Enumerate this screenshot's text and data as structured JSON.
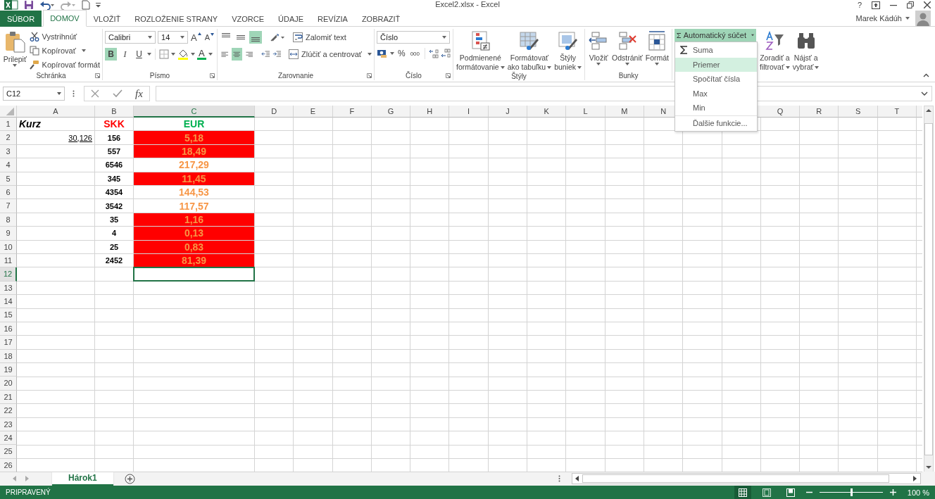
{
  "title_bar": {
    "title": "Excel2.xlsx - Excel",
    "help": "?"
  },
  "tabs": [
    {
      "label": "SÚBOR",
      "kind": "file",
      "selected": false
    },
    {
      "label": "DOMOV",
      "kind": "tab",
      "selected": true
    },
    {
      "label": "VLOŽIŤ",
      "kind": "tab",
      "selected": false
    },
    {
      "label": "ROZLOŽENIE STRANY",
      "kind": "tab",
      "selected": false
    },
    {
      "label": "VZORCE",
      "kind": "tab",
      "selected": false
    },
    {
      "label": "ÚDAJE",
      "kind": "tab",
      "selected": false
    },
    {
      "label": "REVÍZIA",
      "kind": "tab",
      "selected": false
    },
    {
      "label": "ZOBRAZIŤ",
      "kind": "tab",
      "selected": false
    }
  ],
  "user": {
    "name": "Marek Kádúh"
  },
  "ribbon": {
    "clipboard": {
      "label": "Schránka",
      "paste": "Prilepiť",
      "cut": "Vystrihnúť",
      "copy": "Kopírovať",
      "format_painter": "Kopírovať formát"
    },
    "font": {
      "label": "Písmo",
      "family": "Calibri",
      "size": "14",
      "grow": "A",
      "shrink": "A",
      "styles": [
        {
          "label": "B",
          "kind": "bold",
          "on": true
        },
        {
          "label": "I",
          "kind": "italic",
          "on": false
        },
        {
          "label": "U",
          "kind": "underline",
          "on": false
        }
      ],
      "color_letter": "A"
    },
    "alignment": {
      "label": "Zarovnanie",
      "vertical": [
        {
          "kind": "top",
          "on": false
        },
        {
          "kind": "middle",
          "on": false
        },
        {
          "kind": "bottom",
          "on": true
        }
      ],
      "horizontal": [
        {
          "kind": "left",
          "on": false
        },
        {
          "kind": "center",
          "on": true
        },
        {
          "kind": "right",
          "on": false
        }
      ],
      "wrap": "Zalomiť text",
      "merge": "Zlúčiť a centrovať"
    },
    "number": {
      "label": "Číslo",
      "format": "Číslo",
      "percent": "%",
      "thousands": "000"
    },
    "styles": {
      "label": "Štýly",
      "buttons": [
        {
          "kind": "conditional",
          "line1": "Podmienené",
          "line2": "formátovanie"
        },
        {
          "kind": "table",
          "line1": "Formátovať",
          "line2": "ako tabuľku"
        },
        {
          "kind": "cellstyle",
          "line1": "Štýly",
          "line2": "buniek"
        }
      ]
    },
    "cells": {
      "label": "Bunky",
      "buttons": [
        {
          "kind": "insert",
          "label": "Vložiť"
        },
        {
          "kind": "delete",
          "label": "Odstrániť"
        },
        {
          "kind": "format",
          "label": "Formát"
        }
      ]
    },
    "editing": {
      "autosum": "Automatický súčet",
      "autosum_open": true,
      "buttons": [
        {
          "kind": "sort",
          "line1": "Zoradiť a",
          "line2": "filtrovať"
        },
        {
          "kind": "find",
          "line1": "Nájsť a",
          "line2": "vybrať"
        }
      ]
    }
  },
  "autosum_menu": [
    {
      "label": "Suma",
      "kind": "sum",
      "selected": false
    },
    {
      "label": "Priemer",
      "kind": "plain",
      "selected": true
    },
    {
      "label": "Spočítať čísla",
      "kind": "plain",
      "selected": false
    },
    {
      "label": "Max",
      "kind": "plain",
      "selected": false
    },
    {
      "label": "Min",
      "kind": "plain",
      "selected": false
    },
    {
      "label": "Ďalšie funkcie...",
      "kind": "more",
      "selected": false
    }
  ],
  "formula_bar": {
    "name_box": "C12",
    "fx": "fx"
  },
  "sheet": {
    "columns": [
      {
        "label": "A",
        "selected": false
      },
      {
        "label": "B",
        "selected": false
      },
      {
        "label": "C",
        "selected": true
      },
      {
        "label": "D",
        "selected": false
      },
      {
        "label": "E",
        "selected": false
      },
      {
        "label": "F",
        "selected": false
      },
      {
        "label": "G",
        "selected": false
      },
      {
        "label": "H",
        "selected": false
      },
      {
        "label": "I",
        "selected": false
      },
      {
        "label": "J",
        "selected": false
      },
      {
        "label": "K",
        "selected": false
      },
      {
        "label": "L",
        "selected": false
      },
      {
        "label": "M",
        "selected": false
      },
      {
        "label": "N",
        "selected": false
      },
      {},
      {},
      {
        "label": "Q",
        "selected": false
      },
      {
        "label": "R",
        "selected": false
      },
      {
        "label": "S",
        "selected": false
      },
      {
        "label": "T",
        "selected": false
      }
    ],
    "rows": [
      {
        "number": "1",
        "kind": "header",
        "selected": false,
        "a": "Kurz",
        "b": "SKK",
        "c": "EUR"
      },
      {
        "number": "2",
        "kind": "data",
        "selected": false,
        "a": "30,126",
        "b": "156",
        "c": "5,18",
        "c_fill": true
      },
      {
        "number": "3",
        "kind": "data",
        "selected": false,
        "b": "557",
        "c": "18,49",
        "c_fill": true
      },
      {
        "number": "4",
        "kind": "data",
        "selected": false,
        "b": "6546",
        "c": "217,29",
        "c_fill": false
      },
      {
        "number": "5",
        "kind": "data",
        "selected": false,
        "b": "345",
        "c": "11,45",
        "c_fill": true
      },
      {
        "number": "6",
        "kind": "data",
        "selected": false,
        "b": "4354",
        "c": "144,53",
        "c_fill": false
      },
      {
        "number": "7",
        "kind": "data",
        "selected": false,
        "b": "3542",
        "c": "117,57",
        "c_fill": false
      },
      {
        "number": "8",
        "kind": "data",
        "selected": false,
        "b": "35",
        "c": "1,16",
        "c_fill": true
      },
      {
        "number": "9",
        "kind": "data",
        "selected": false,
        "b": "4",
        "c": "0,13",
        "c_fill": true
      },
      {
        "number": "10",
        "kind": "data",
        "selected": false,
        "b": "25",
        "c": "0,83",
        "c_fill": true
      },
      {
        "number": "11",
        "kind": "data",
        "selected": false,
        "b": "2452",
        "c": "81,39",
        "c_fill": true
      },
      {
        "number": "12",
        "selected": true
      },
      {
        "number": "13",
        "selected": false
      },
      {
        "number": "14",
        "selected": false
      },
      {
        "number": "15",
        "selected": false
      },
      {
        "number": "16",
        "selected": false
      },
      {
        "number": "17",
        "selected": false
      },
      {
        "number": "18",
        "selected": false
      },
      {
        "number": "19",
        "selected": false
      },
      {
        "number": "20",
        "selected": false
      },
      {
        "number": "21",
        "selected": false
      },
      {
        "number": "22",
        "selected": false
      },
      {
        "number": "23",
        "selected": false
      },
      {
        "number": "24",
        "selected": false
      },
      {
        "number": "25",
        "selected": false
      },
      {
        "number": "26",
        "selected": false
      }
    ]
  },
  "sheet_tabs": [
    {
      "label": "Hárok1",
      "selected": true
    }
  ],
  "status_bar": {
    "text": "PRIPRAVENÝ",
    "views": [
      {
        "kind": "normal",
        "selected": true
      },
      {
        "kind": "layout",
        "selected": false
      },
      {
        "kind": "break",
        "selected": false
      }
    ],
    "zoom": {
      "level": 0.5,
      "label": "100 %"
    }
  }
}
